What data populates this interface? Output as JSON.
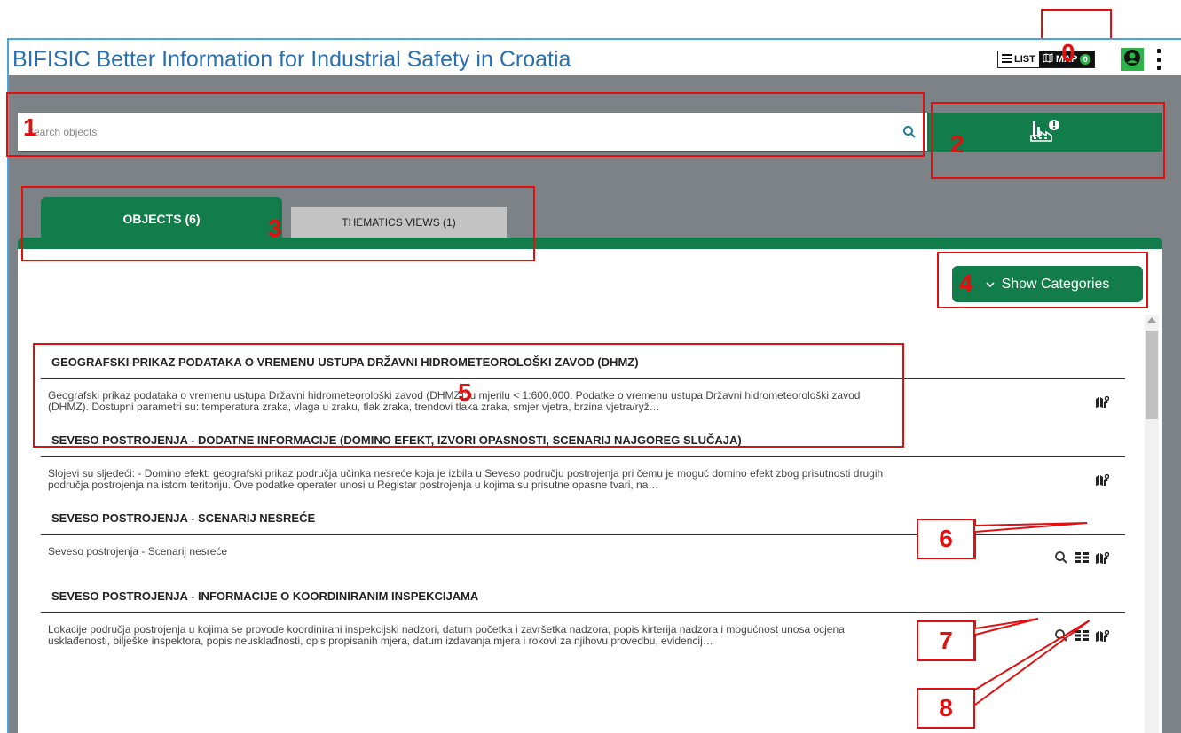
{
  "app": {
    "title": "BIFISIC Better Information for Industrial Safety in Croatia"
  },
  "view_toggle": {
    "list_label": "LIST",
    "map_label": "MAP",
    "map_count": "0"
  },
  "search": {
    "placeholder": "Search objects"
  },
  "tabs": [
    {
      "label": "OBJECTS (6)",
      "active": true
    },
    {
      "label": "THEMATICS VIEWS (1)",
      "active": false
    }
  ],
  "show_categories": {
    "label": "Show Categories"
  },
  "items": [
    {
      "title": "GEOGRAFSKI PRIKAZ PODATAKA O VREMENU USTUPA DRŽAVNI HIDROMETEOROLOŠKI ZAVOD (DHMZ)",
      "description": "Geografski prikaz podataka o vremenu ustupa Državni hidrometeorološki zavod (DHMZ); u mjerilu < 1:600.000. Podatke o vremenu ustupa Državni hidrometeorološki zavod (DHMZ). Dostupni parametri su: temperatura zraka, vlaga u zraku, tlak zraka, trendovi tlaka zraka, smjer vjetra, brzina vjetra/rуž…"
    },
    {
      "title": "SEVESO POSTROJENJA - DODATNE INFORMACIJE (DOMINO EFEKT, IZVORI OPASNOSTI, SCENARIJ NAJGOREG SLUČAJA)",
      "description": "Slojevi su sljedeći: - Domino efekt: geografski prikaz područja učinka nesreće koja je izbila u Seveso području postrojenja pri čemu je moguć domino efekt zbog prisutnosti drugih područja postrojenja na istom teritoriju. Ove podatke operater unosi u Registar postrojenja u kojima su prisutne opasne tvari, na…"
    },
    {
      "title": "SEVESO POSTROJENJA - SCENARIJ NESREĆE",
      "description": "Seveso postrojenja - Scenarij nesreće"
    },
    {
      "title": "SEVESO POSTROJENJA - INFORMACIJE O KOORDINIRANIM INSPEKCIJAMA",
      "description": "Lokacije područja postrojenja u kojima se provode koordinirani inspekcijski nadzori, datum početka i završetka nadzora, popis kirterija nadzora i mogućnost unosa ocjena usklađenosti, bilješke inspektora, popis neusklađnosti, opis propisanih mjera, datum izdavanja mjera i rokovi za njihovu provedbu, evidencij…"
    }
  ],
  "annotations": [
    "0",
    "1",
    "2",
    "3",
    "4",
    "5",
    "6",
    "7",
    "8"
  ],
  "colors": {
    "primary_green": "#127c4a",
    "badge_green": "#2db34a",
    "annotation_red": "#e01010",
    "title_blue": "#2a6fb0"
  }
}
